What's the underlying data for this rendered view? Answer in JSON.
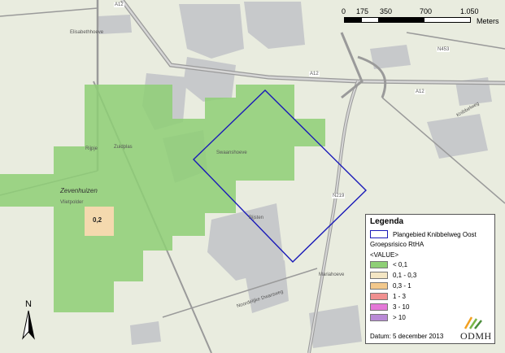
{
  "scale": {
    "ticks": [
      "0",
      "175",
      "350",
      "700",
      "1.050"
    ],
    "unit": "Meters"
  },
  "map_labels": {
    "zevenhuizen": "Zevenhuizen",
    "a12_north": "A12",
    "a12_east_1": "A12",
    "a12_east_2": "A12",
    "n219": "N219",
    "n453": "N453",
    "elisabethhoeve": "Elisabethhoeve",
    "swaanshoeve": "Swaanshoeve",
    "rijpje": "Rijpje",
    "zuidplas": "Zuidplas",
    "vlietpolder": "Vlietpolder",
    "bijsten": "Bijsten",
    "mariahoeve": "Mariahoeve",
    "knibbelweg": "Knibbelweg",
    "noordelijke": "Noordelijke Dwarsweg"
  },
  "risk_value_label": "0,2",
  "north": "N",
  "legend": {
    "title": "Legenda",
    "plan_label": "Plangebied Knibbelweg Oost",
    "group_title": "Groepsrisico RtHA",
    "value_label": "<VALUE>",
    "classes": [
      {
        "label": "< 0,1",
        "color": "#8ecf76"
      },
      {
        "label": "0,1 - 0,3",
        "color": "#f4e6c4"
      },
      {
        "label": "0,3 - 1",
        "color": "#f2c88c"
      },
      {
        "label": "1 - 3",
        "color": "#f09090"
      },
      {
        "label": "3 - 10",
        "color": "#e478d8"
      },
      {
        "label": "> 10",
        "color": "#b98ad6"
      }
    ],
    "date": "Datum: 5 december 2013",
    "logo": "ODMH"
  },
  "colors": {
    "plan_outline": "#1a1ab8",
    "risk_green": "#8ecf76"
  }
}
